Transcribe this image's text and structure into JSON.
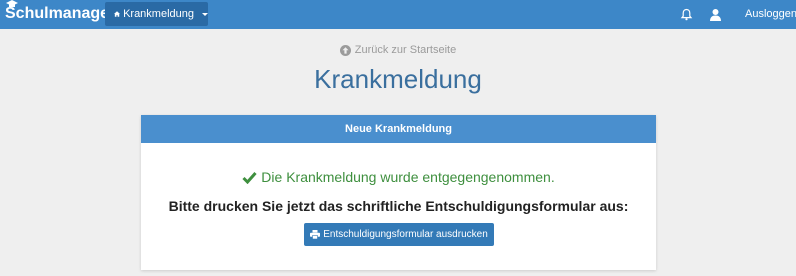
{
  "navbar": {
    "brand": "Schulmanager",
    "module_dropdown": {
      "label": "Krankmeldung",
      "icon": "home-icon"
    },
    "notifications_icon": "bell-icon",
    "user_icon": "user-icon",
    "logout_label": "Ausloggen"
  },
  "main": {
    "back_link": "Zurück zur Startseite",
    "title": "Krankmeldung"
  },
  "panel": {
    "heading": "Neue Krankmeldung",
    "success_message": "Die Krankmeldung wurde entgegengenommen.",
    "instruction": "Bitte drucken Sie jetzt das schriftliche Entschuldigungsformular aus:",
    "print_button_label": "Entschuldigungsformular ausdrucken"
  },
  "colors": {
    "navbar": "#3d87c8",
    "panel_heading": "#4a8fce",
    "button": "#337ab7",
    "success": "#3e8f3e",
    "title": "#3a6f9e"
  }
}
